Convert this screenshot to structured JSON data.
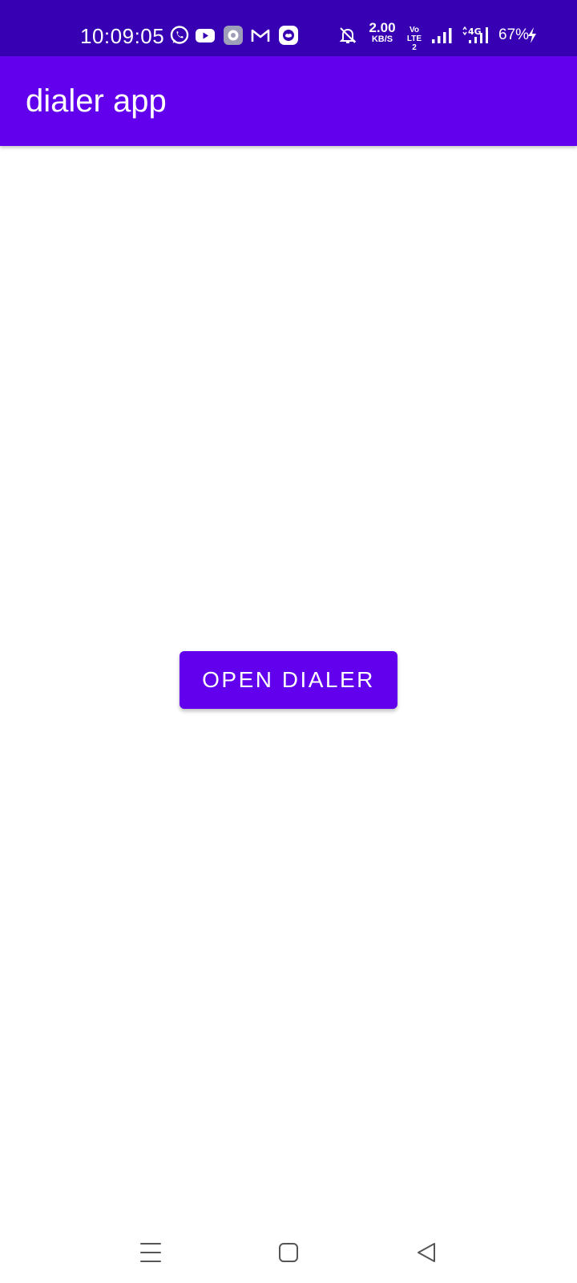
{
  "status_bar": {
    "time": "10:09:05",
    "net_speed_value": "2.00",
    "net_speed_unit": "KB/S",
    "volte_line1": "Vo",
    "volte_line2": "LTE 2",
    "network_type": "4G",
    "battery_percent": "67%",
    "icons": [
      "whatsapp-icon",
      "youtube-icon",
      "settings-app-icon",
      "gmail-icon",
      "cloud-app-icon",
      "bell-off-icon",
      "signal-icon",
      "signal-4g-icon",
      "charging-bolt-icon"
    ],
    "background_color": "#3700b3"
  },
  "app_bar": {
    "title": "dialer app",
    "background_color": "#6200ee"
  },
  "main": {
    "open_dialer_label": "OPEN DIALER",
    "button_color": "#6200ee"
  },
  "nav_bar": {
    "items": [
      "menu",
      "home",
      "back"
    ]
  }
}
